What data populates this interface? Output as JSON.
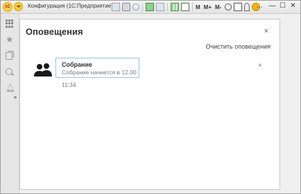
{
  "window": {
    "title": "Конфигурация  (1С:Предприятие)",
    "logo_text": "1С",
    "controls": [
      "…",
      "—",
      "☐",
      "✕"
    ]
  },
  "toolbar": {
    "m_label": "M",
    "m_plus_label": "M+",
    "m_minus_label": "M-"
  },
  "sidebar": {
    "items": [
      "apps-icon",
      "star-icon",
      "history-icon",
      "search-icon",
      "bell-icon"
    ]
  },
  "panel": {
    "title": "Оповещения",
    "close_glyph": "×",
    "clear_label": "Очистить оповещения"
  },
  "notifications": [
    {
      "title": "Собрание",
      "text": "Собрание начнется в 12.00",
      "time": "11:34",
      "close_glyph": "×",
      "icon": "people-icon"
    }
  ]
}
